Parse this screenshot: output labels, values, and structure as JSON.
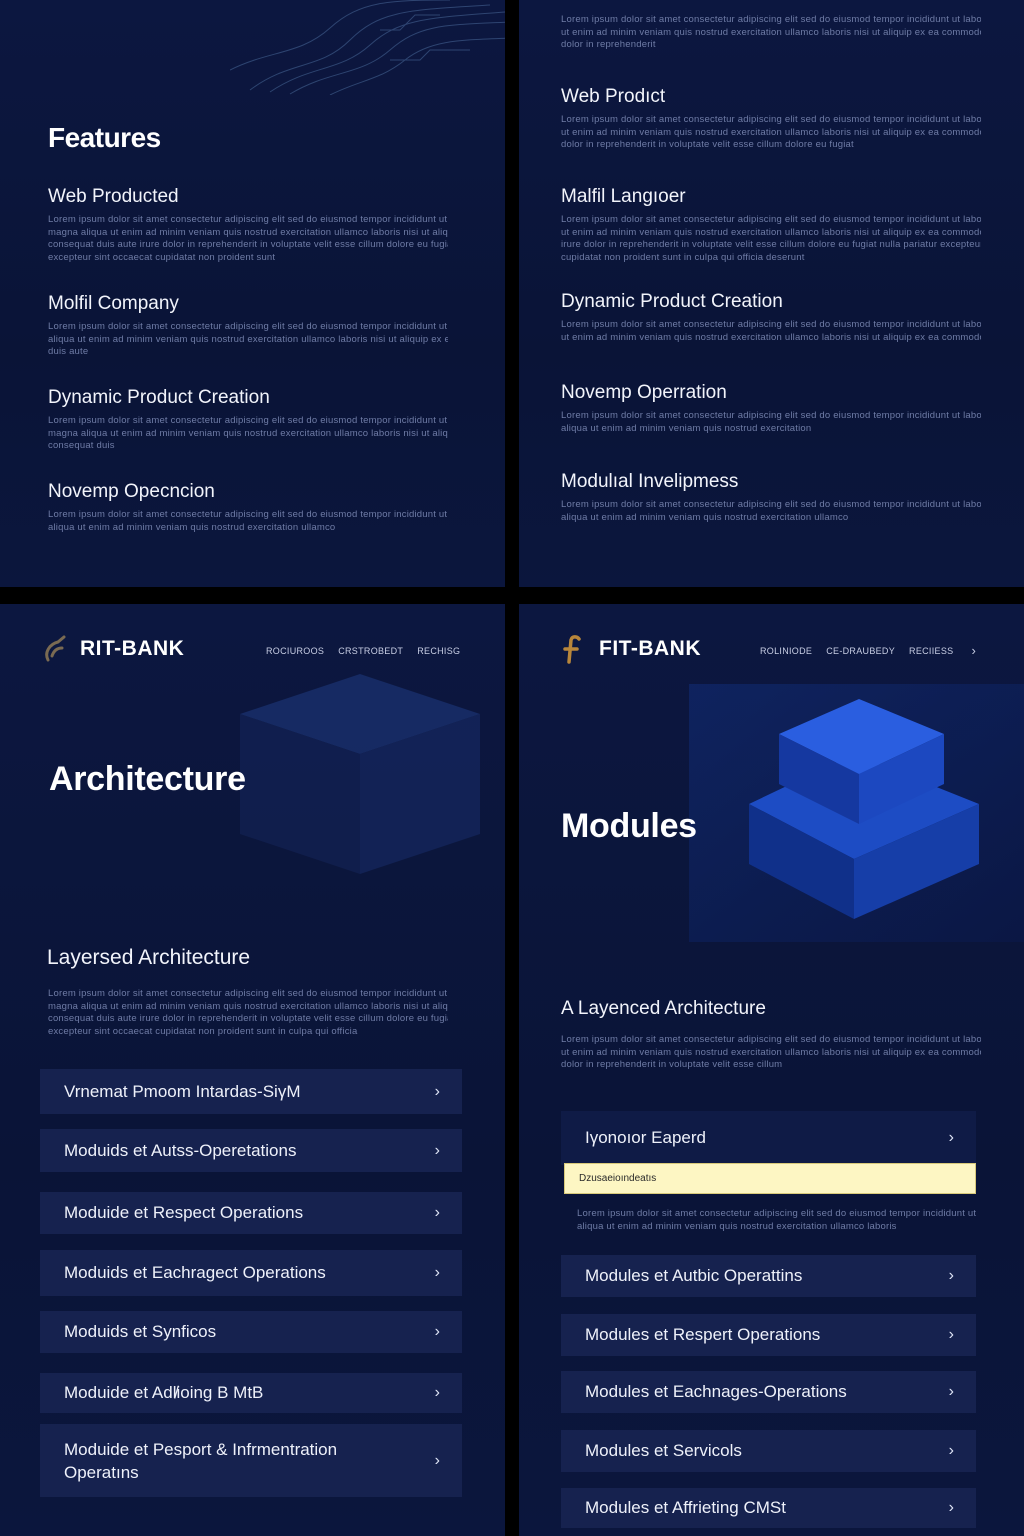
{
  "panel1": {
    "title": "Features",
    "features": [
      {
        "heading": "Web Producted",
        "lines": [
          "Lorem ipsum dolor sit amet consectetur adipiscing elit sed do eiusmod tempor incididunt ut labore et dolore",
          "magna aliqua ut enim ad minim veniam quis nostrud exercitation ullamco laboris nisi ut aliquip ex ea commodo",
          "consequat duis aute irure dolor in reprehenderit in voluptate velit esse cillum dolore eu fugiat nulla pariatur",
          "excepteur sint occaecat cupidatat non proident sunt"
        ]
      },
      {
        "heading": "Molfil Company",
        "lines": [
          "Lorem ipsum dolor sit amet consectetur adipiscing elit sed do eiusmod tempor incididunt ut labore et dolore magna",
          "aliqua ut enim ad minim veniam quis nostrud exercitation ullamco laboris nisi ut aliquip ex ea commodo conseq",
          "duis aute"
        ]
      },
      {
        "heading": "Dynamic Product Creation",
        "lines": [
          "Lorem ipsum dolor sit amet consectetur adipiscing elit sed do eiusmod tempor incididunt ut labore et dolore",
          "magna aliqua ut enim ad minim veniam quis nostrud exercitation ullamco laboris nisi ut aliquip ex ea commodo",
          "consequat duis"
        ]
      },
      {
        "heading": "Novemp Opecncion",
        "lines": [
          "Lorem ipsum dolor sit amet consectetur adipiscing elit sed do eiusmod tempor incididunt ut labore et dolore magna",
          "aliqua ut enim ad minim veniam quis nostrud exercitation ullamco"
        ]
      }
    ]
  },
  "panel2": {
    "intro": [
      "Lorem ipsum dolor sit amet consectetur adipiscing elit sed do eiusmod tempor incididunt ut labore et dolore magna aliqua",
      "ut enim ad minim veniam quis nostrud exercitation ullamco laboris nisi ut aliquip ex ea commodo consequat duis aute irure",
      "dolor in reprehenderit"
    ],
    "features": [
      {
        "heading": "Web Prodıct",
        "lines": [
          "Lorem ipsum dolor sit amet consectetur adipiscing elit sed do eiusmod tempor incididunt ut labore et dolore magna aliqua",
          "ut enim ad minim veniam quis nostrud exercitation ullamco laboris nisi ut aliquip ex ea commodo consequat duis aute irure",
          "dolor in reprehenderit in voluptate velit esse cillum dolore eu fugiat"
        ]
      },
      {
        "heading": "Malfil Langıoer",
        "lines": [
          "Lorem ipsum dolor sit amet consectetur adipiscing elit sed do eiusmod tempor incididunt ut labore et dolore magna aliqua",
          "ut enim ad minim veniam quis nostrud exercitation ullamco laboris nisi ut aliquip ex ea commodo consequat duis aute",
          "irure dolor in reprehenderit in voluptate velit esse cillum dolore eu fugiat nulla pariatur excepteur sint occaecat",
          "cupidatat non proident sunt in culpa qui officia deserunt"
        ]
      },
      {
        "heading": "Dynamic Product Creation",
        "lines": [
          "Lorem ipsum dolor sit amet consectetur adipiscing elit sed do eiusmod tempor incididunt ut labore et dolore magna aliqua",
          "ut enim ad minim veniam quis nostrud exercitation ullamco laboris nisi ut aliquip ex ea commodo consequat"
        ]
      },
      {
        "heading": "Novemp Operration",
        "lines": [
          "Lorem ipsum dolor sit amet consectetur adipiscing elit sed do eiusmod tempor incididunt ut labore et dolore magna",
          "aliqua ut enim ad minim veniam quis nostrud exercitation"
        ]
      },
      {
        "heading": "Modulıal Invelipmess",
        "lines": [
          "Lorem ipsum dolor sit amet consectetur adipiscing elit sed do eiusmod tempor incididunt ut labore et dolore magna",
          "aliqua ut enim ad minim veniam quis nostrud exercitation ullamco"
        ]
      }
    ]
  },
  "panel3": {
    "brand": "RIT-BANK",
    "nav": [
      "ROCIUROOS",
      "CRSTROBEDT",
      "RECHISG"
    ],
    "hero_title": "Architecture",
    "section_title": "Layersed Architecture",
    "section_lines": [
      "Lorem ipsum dolor sit amet consectetur adipiscing elit sed do eiusmod tempor incididunt ut labore et dolore",
      "magna aliqua ut enim ad minim veniam quis nostrud exercitation ullamco laboris nisi ut aliquip ex ea commodo",
      "consequat duis aute irure dolor in reprehenderit in voluptate velit esse cillum dolore eu fugiat nulla pariatur",
      "excepteur sint occaecat cupidatat non proident sunt in culpa qui officia"
    ],
    "items": [
      "Vrnemat Pmoom Intardas-SiγM",
      "Moduids et Autss-Operetations",
      "Moduide et Respect Operations",
      "Moduids et Eachragect Operations",
      "Moduids et Synficos",
      "Moduide et Adl̸ioing B MtB",
      "Moduide et Pesport & Infrmentration Operatıns"
    ]
  },
  "panel4": {
    "brand": "FIT-BANK",
    "nav": [
      "ROLINIODE",
      "CE-DRAUBEDY",
      "RECIIESS"
    ],
    "hero_title": "Modules",
    "section_title": "A Layenced Architecture",
    "section_lines": [
      "Lorem ipsum dolor sit amet consectetur adipiscing elit sed do eiusmod tempor incididunt ut labore et dolore magna aliqua",
      "ut enim ad minim veniam quis nostrud exercitation ullamco laboris nisi ut aliquip ex ea commodo consequat duis aute irure",
      "dolor in reprehenderit in voluptate velit esse cillum"
    ],
    "expanded_item": "Iγonoıor Eaperd",
    "highlight_text": "Dzusaeioındeatıs",
    "expanded_lines": [
      "Lorem ipsum dolor sit amet consectetur adipiscing elit sed do eiusmod tempor incididunt ut labore et dolore magna",
      "aliqua ut enim ad minim veniam quis nostrud exercitation ullamco laboris"
    ],
    "items": [
      "Modules et Autbic Operattins",
      "Modules et Respert Operations",
      "Modules et Eachnages-Operations",
      "Modules et Servicols",
      "Modules et Affrieting CMSt"
    ]
  },
  "colors": {
    "panel_bg": "#0c1740",
    "accordion_bg": "#16224f",
    "accent_blue": "#1d4cc4",
    "highlight": "#fdf6c3",
    "logo_gold": "#b8863b"
  },
  "icons": {
    "chevron": "chevron-right-icon"
  }
}
